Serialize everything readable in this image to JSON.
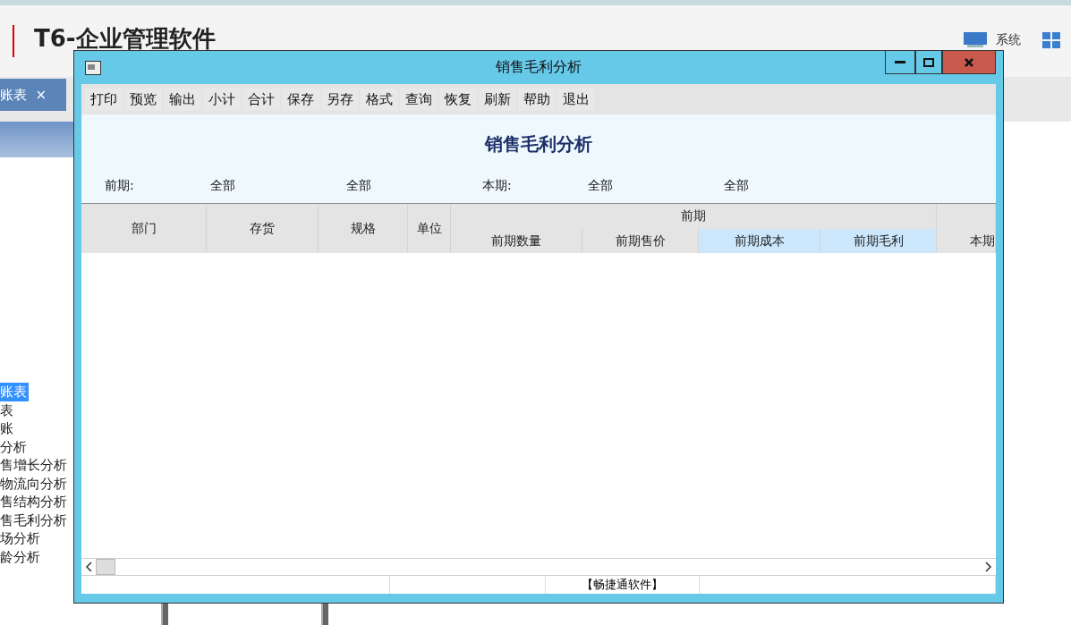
{
  "app": {
    "logo": "T6-企业管理软件",
    "tab": {
      "label": "账表",
      "close": "×"
    },
    "system_label": "系统",
    "tree_items": [
      {
        "label": "账表",
        "selected": true
      },
      {
        "label": "表",
        "selected": false
      },
      {
        "label": "账",
        "selected": false
      },
      {
        "label": "分析",
        "selected": false
      },
      {
        "label": "售增长分析",
        "selected": false
      },
      {
        "label": "物流向分析",
        "selected": false
      },
      {
        "label": "售结构分析",
        "selected": false
      },
      {
        "label": "售毛利分析",
        "selected": false
      },
      {
        "label": "场分析",
        "selected": false
      },
      {
        "label": "龄分析",
        "selected": false
      }
    ]
  },
  "window": {
    "title": "销售毛利分析",
    "toolbar": [
      "打印",
      "预览",
      "输出",
      "小计",
      "合计",
      "保存",
      "另存",
      "格式",
      "查询",
      "恢复",
      "刷新",
      "帮助",
      "退出"
    ],
    "report_title": "销售毛利分析",
    "filters": [
      {
        "label": "前期:",
        "from": "全部",
        "to": "全部"
      },
      {
        "label": "本期:",
        "from": "全部",
        "to": "全部"
      }
    ],
    "columns": [
      {
        "label": "部门"
      },
      {
        "label": "存货"
      },
      {
        "label": "规格"
      },
      {
        "label": "单位"
      }
    ],
    "group": {
      "label": "前期",
      "columns": [
        {
          "label": "前期数量",
          "selected": false
        },
        {
          "label": "前期售价",
          "selected": false
        },
        {
          "label": "前期成本",
          "selected": true
        },
        {
          "label": "前期毛利",
          "selected": true
        }
      ]
    },
    "cut_column": "本期",
    "status": "【畅捷通软件】"
  }
}
